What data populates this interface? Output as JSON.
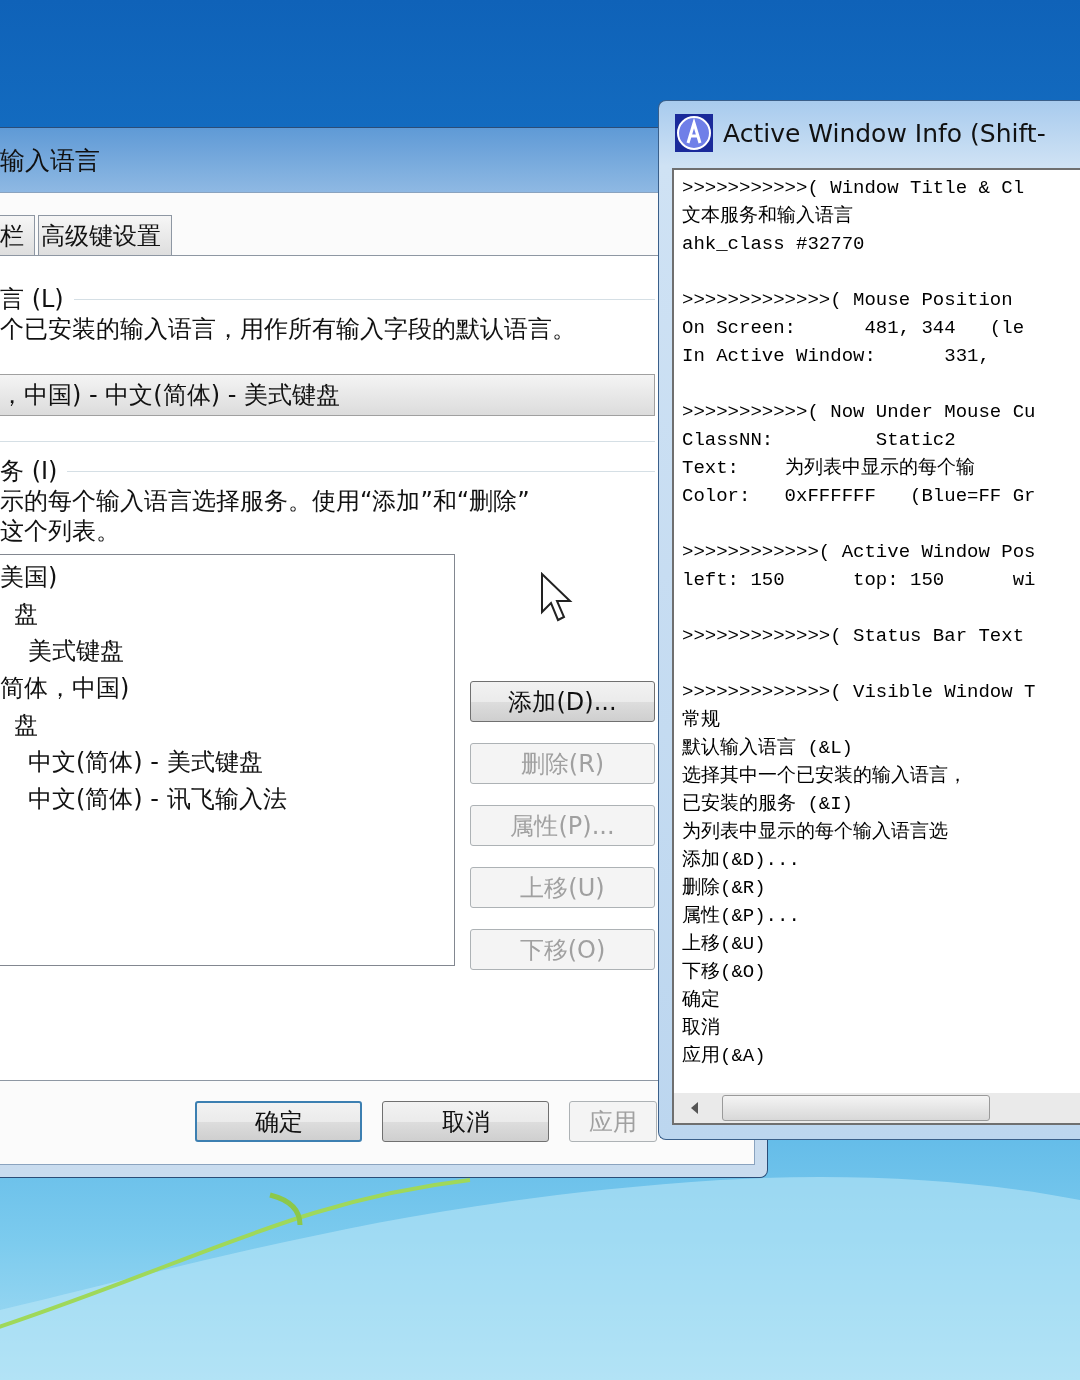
{
  "dialog": {
    "title": "输入语言",
    "tabs": [
      {
        "label": "栏",
        "selected": false
      },
      {
        "label": "高级键设置",
        "selected": false
      }
    ],
    "default_language": {
      "label": "言 (L)",
      "description": "个已安装的输入语言，用作所有输入字段的默认语言。",
      "dropdown_value": "，中国) - 中文(简体) - 美式键盘"
    },
    "installed_services": {
      "label": "务 (I)",
      "description_lines": [
        "示的每个输入语言选择服务。使用“添加”和“删除”",
        "这个列表。"
      ],
      "tree": [
        {
          "label": "美国)",
          "children": [
            {
              "label": "盘",
              "children": [
                {
                  "label": "美式键盘"
                }
              ]
            }
          ]
        },
        {
          "label": "简体，中国)",
          "children": [
            {
              "label": "盘",
              "children": [
                {
                  "label": "中文(简体) - 美式键盘"
                },
                {
                  "label": "中文(简体) - 讯飞输入法"
                }
              ]
            }
          ]
        }
      ],
      "side_buttons": [
        {
          "label": "添加(D)...",
          "disabled": false
        },
        {
          "label": "删除(R)",
          "disabled": true
        },
        {
          "label": "属性(P)...",
          "disabled": true
        },
        {
          "label": "上移(U)",
          "disabled": true
        },
        {
          "label": "下移(O)",
          "disabled": true
        }
      ]
    },
    "footer_buttons": [
      {
        "label": "确定",
        "default": true,
        "disabled": false
      },
      {
        "label": "取消",
        "default": false,
        "disabled": false
      },
      {
        "label": "应用",
        "default": false,
        "disabled": true
      }
    ]
  },
  "info_window": {
    "title": "Active Window Info (Shift-",
    "sections": [
      {
        "lines": [
          ">>>>>>>>>>>( Window Title & Cl",
          "文本服务和输入语言",
          "ahk_class #32770"
        ]
      },
      {
        "lines": [
          ">>>>>>>>>>>>>( Mouse Position",
          "On Screen:      481, 344   (le",
          "In Active Window:      331,"
        ]
      },
      {
        "lines": [
          ">>>>>>>>>>>( Now Under Mouse Cu",
          "ClassNN:         Static2",
          "Text:    为列表中显示的每个输",
          "Color:   0xFFFFFF   (Blue=FF Gr"
        ]
      },
      {
        "lines": [
          ">>>>>>>>>>>>( Active Window Pos",
          "left: 150      top: 150      wi"
        ]
      },
      {
        "lines": [
          ">>>>>>>>>>>>>( Status Bar Text"
        ]
      },
      {
        "lines": [
          ">>>>>>>>>>>>>( Visible Window T",
          "常规",
          "默认输入语言 (&L)",
          "选择其中一个已安装的输入语言，",
          "已安装的服务 (&I)",
          "为列表中显示的每个输入语言选",
          "添加(&D)...",
          "删除(&R)",
          "属性(&P)...",
          "上移(&U)",
          "下移(&O)",
          "确定",
          "取消",
          "应用(&A)"
        ]
      }
    ]
  }
}
